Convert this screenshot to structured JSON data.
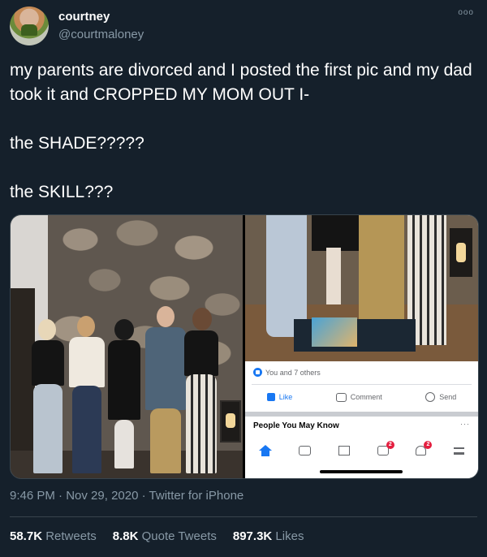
{
  "user": {
    "name": "courtney",
    "handle": "@courtmaloney",
    "more_label": "ooo"
  },
  "tweet": {
    "line1": "my parents are divorced and I posted the first pic and my dad took it and CROPPED MY MOM OUT I-",
    "line2": "the SHADE?????",
    "line3": "the SKILL???"
  },
  "facebook_screenshot": {
    "reactions": "You and 7 others",
    "like": "Like",
    "comment": "Comment",
    "send": "Send",
    "section_title": "People You May Know",
    "section_more": "···",
    "groups_badge": "2",
    "notifications_badge": "2"
  },
  "meta": {
    "time": "9:46 PM",
    "separator": "·",
    "date": "Nov 29, 2020",
    "source": "Twitter for iPhone"
  },
  "stats": {
    "retweets_count": "58.7K",
    "retweets_label": "Retweets",
    "quotes_count": "8.8K",
    "quotes_label": "Quote Tweets",
    "likes_count": "897.3K",
    "likes_label": "Likes"
  },
  "colors": {
    "background": "#15202b",
    "secondary_text": "#8899a6",
    "divider": "#38444d",
    "facebook_blue": "#1877f2"
  }
}
